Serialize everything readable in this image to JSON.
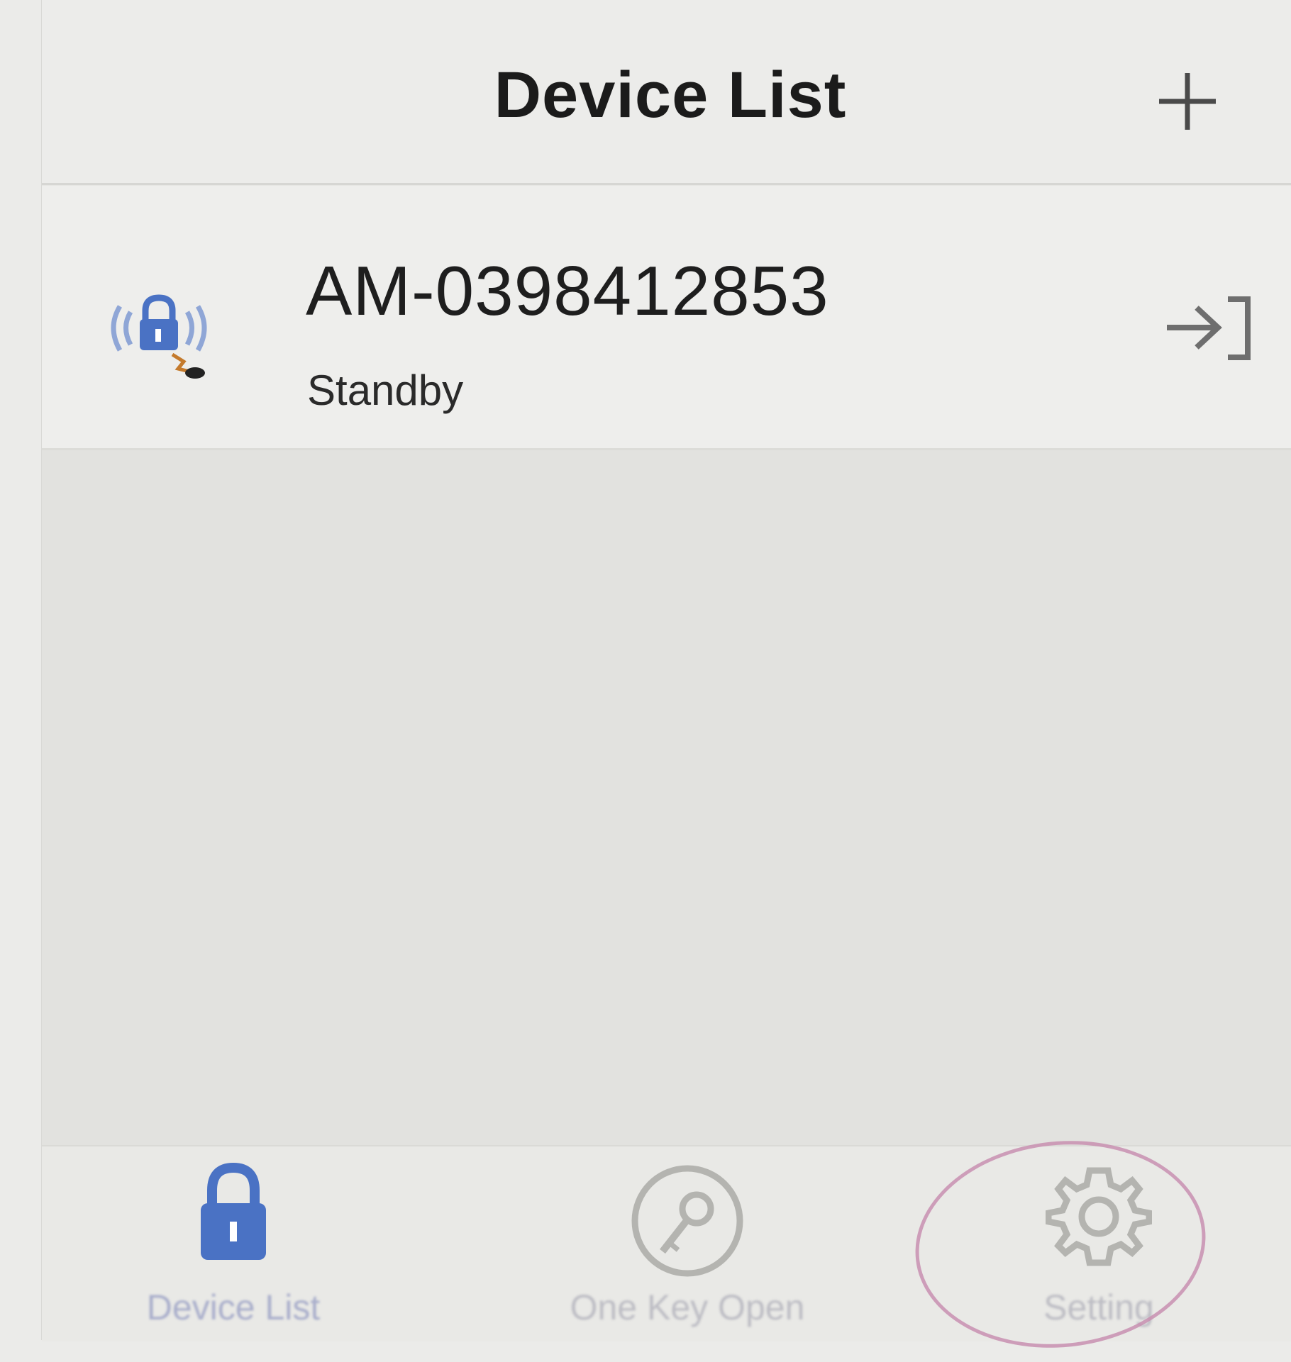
{
  "header": {
    "title": "Device List",
    "add_icon": "plus-icon"
  },
  "devices": [
    {
      "name": "AM-0398412853",
      "status": "Standby",
      "icon": "bluetooth-lock-icon",
      "action_icon": "enter-icon"
    }
  ],
  "tabs": [
    {
      "label": "Device List",
      "icon": "lock-icon",
      "active": true
    },
    {
      "label": "One Key Open",
      "icon": "key-icon",
      "active": false
    },
    {
      "label": "Setting",
      "icon": "gear-icon",
      "active": false
    }
  ],
  "colors": {
    "accent": "#4a72c4",
    "inactive_icon": "#b4b4b0",
    "highlight_ring": "#c88fb0"
  }
}
